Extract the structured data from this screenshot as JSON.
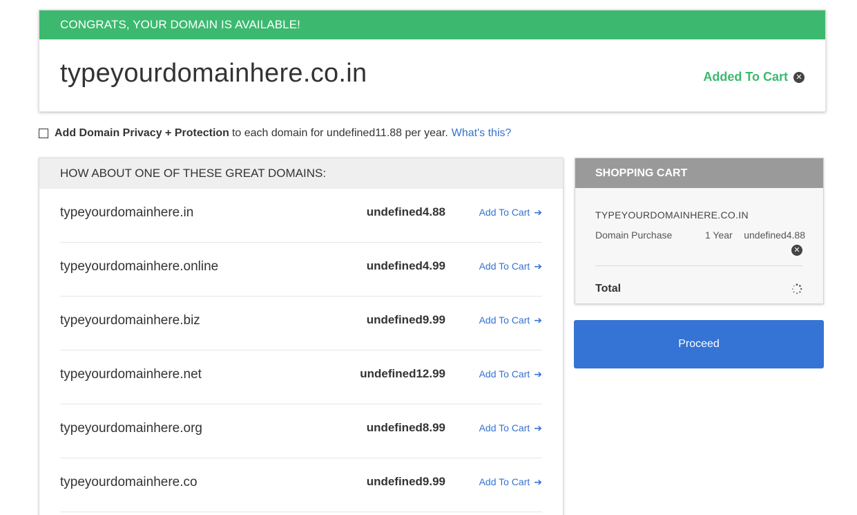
{
  "availability": {
    "banner": "CONGRATS, YOUR DOMAIN IS AVAILABLE!",
    "domain": "typeyourdomainhere.co.in",
    "status_label": "Added To Cart",
    "remove_icon": "close-circle-icon"
  },
  "privacy": {
    "checked": false,
    "bold_label": "Add Domain Privacy + Protection",
    "text": "to each domain for undefined11.88 per year.",
    "link": "What's this?"
  },
  "suggestions": {
    "header": "HOW ABOUT ONE OF THESE GREAT DOMAINS:",
    "add_label": "Add To Cart",
    "items": [
      {
        "domain": "typeyourdomainhere.in",
        "price": "undefined4.88"
      },
      {
        "domain": "typeyourdomainhere.online",
        "price": "undefined4.99"
      },
      {
        "domain": "typeyourdomainhere.biz",
        "price": "undefined9.99"
      },
      {
        "domain": "typeyourdomainhere.net",
        "price": "undefined12.99"
      },
      {
        "domain": "typeyourdomainhere.org",
        "price": "undefined8.99"
      },
      {
        "domain": "typeyourdomainhere.co",
        "price": "undefined9.99"
      }
    ]
  },
  "cart": {
    "title": "SHOPPING CART",
    "item_name": "TYPEYOURDOMAINHERE.CO.IN",
    "item_desc": "Domain Purchase",
    "item_term": "1 Year",
    "item_price": "undefined4.88",
    "total_label": "Total",
    "proceed_label": "Proceed"
  },
  "colors": {
    "success": "#3cb96f",
    "link": "#3472d1",
    "primary_button": "#3574d4",
    "cart_header": "#9a9a9a"
  }
}
